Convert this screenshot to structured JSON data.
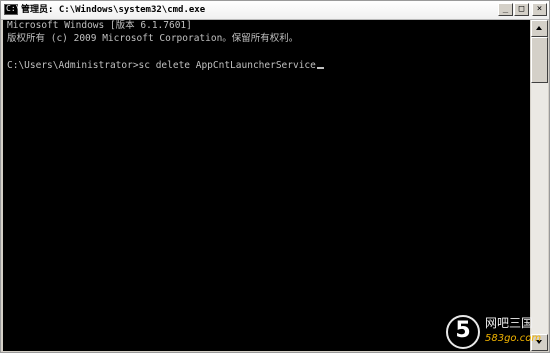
{
  "window": {
    "title": "管理员: C:\\Windows\\system32\\cmd.exe",
    "icon_text": "C:\\",
    "buttons": {
      "minimize": "_",
      "maximize": "□",
      "close": "×"
    }
  },
  "console": {
    "line1": "Microsoft Windows [版本 6.1.7601]",
    "line2": "版权所有 (c) 2009 Microsoft Corporation。保留所有权利。",
    "line4": "C:\\Users\\Administrator>sc delete AppCntLauncherService"
  },
  "watermark": {
    "digit": "5",
    "name": "网吧三国",
    "url": "583go.com"
  }
}
